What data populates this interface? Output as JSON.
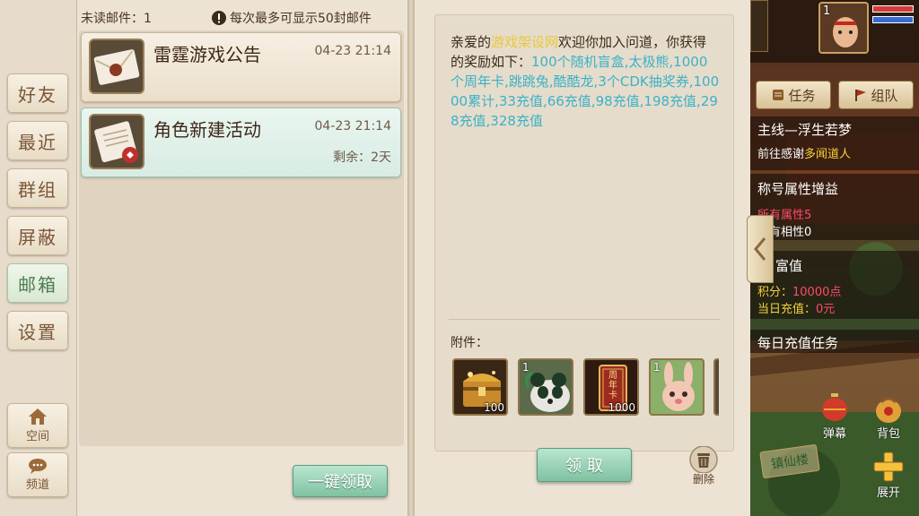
{
  "sidebar": {
    "items": [
      {
        "label": "好友"
      },
      {
        "label": "最近"
      },
      {
        "label": "群组"
      },
      {
        "label": "屏蔽"
      },
      {
        "label": "邮箱"
      },
      {
        "label": "设置"
      }
    ],
    "bottom": [
      {
        "label": "空间",
        "icon": "house-icon"
      },
      {
        "label": "频道",
        "icon": "chat-bubble-icon"
      }
    ]
  },
  "mail_list": {
    "unread_label": "未读邮件：",
    "unread_count": "1",
    "limit_notice": "每次最多可显示50封邮件",
    "items": [
      {
        "title": "雷霆游戏公告",
        "time": "04-23 21:14",
        "remain": ""
      },
      {
        "title": "角色新建活动",
        "time": "04-23 21:14",
        "remain": "剩余：2天"
      }
    ],
    "claim_all_label": "一键领取"
  },
  "mail_content": {
    "greeting": "亲爱的",
    "site_name": "游戏架设网",
    "welcome": "欢迎你加入问道，你获得的奖励如下：",
    "rewards": "100个随机盲盒,太极熊,1000个周年卡,跳跳兔,酷酷龙,3个CDK抽奖券,10000累计,33充值,66充值,98充值,198充值,298充值,328充值",
    "attachment_label": "附件：",
    "attachments": [
      {
        "icon": "treasure-chest-icon",
        "count": "100",
        "num": ""
      },
      {
        "icon": "panda-mount-icon",
        "count": "",
        "num": "1"
      },
      {
        "icon": "anniversary-card-icon",
        "count": "1000",
        "num": "",
        "card_text": "周年卡"
      },
      {
        "icon": "bunny-pet-icon",
        "count": "",
        "num": "1"
      }
    ],
    "claim_label": "领 取",
    "delete_label": "删除"
  },
  "game_hud": {
    "level": "1",
    "task_tab": "任务",
    "team_tab": "组队",
    "quest_title": "主线—浮生若梦",
    "quest_desc_prefix": "前往感谢",
    "quest_target": "多闻道人",
    "title_bonus_label": "称号属性增益",
    "bonus_1": "所有属性5",
    "bonus_2": "所有相性0",
    "wealth_label": "富值",
    "points_label": "积分：",
    "points_value": "10000点",
    "daily_recharge_label": "当日充值：",
    "daily_recharge_value": "0元",
    "daily_task_label": "每日充值任务",
    "btn_danmu": "弹幕",
    "btn_bag": "背包",
    "btn_expand": "展开",
    "sign_text": "镇仙楼"
  },
  "colors": {
    "highlight_yellow": "#e8c93a",
    "highlight_cyan": "#3ab2c8",
    "accent_green": "#7fc2a2"
  }
}
